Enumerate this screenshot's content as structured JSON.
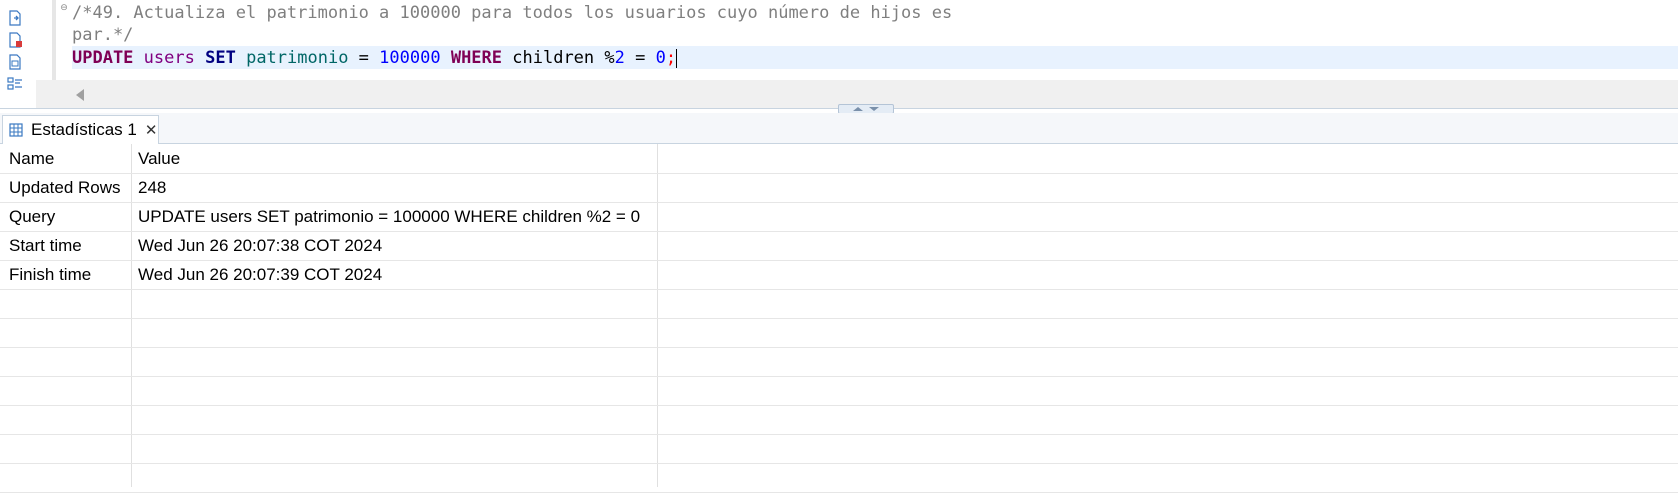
{
  "editor": {
    "comment_line1": "/*49. Actualiza el patrimonio a 100000 para todos los usuarios cuyo número de hijos es",
    "comment_line2": "par.*/",
    "sql": {
      "kw_update": "UPDATE",
      "table": "users",
      "kw_set": "SET",
      "column": "patrimonio",
      "eq1": " = ",
      "value": "100000",
      "kw_where": "WHERE",
      "cond_col": "children",
      "mod": " %",
      "mod_num": "2",
      "eq2": " = ",
      "zero": "0",
      "semicolon": ";"
    },
    "toolbar_icons": [
      "execute-statement-icon",
      "execute-script-icon",
      "explain-plan-icon",
      "outline-icon"
    ]
  },
  "results": {
    "tab_label": "Estadísticas 1",
    "tab_close": "✕",
    "columns": [
      "Name",
      "Value"
    ],
    "rows": [
      [
        "Updated Rows",
        "248"
      ],
      [
        "Query",
        "UPDATE users SET patrimonio = 100000 WHERE children %2 = 0"
      ],
      [
        "Start time",
        "Wed Jun 26 20:07:38 COT 2024"
      ],
      [
        "Finish time",
        "Wed Jun 26 20:07:39 COT 2024"
      ]
    ]
  },
  "colors": {
    "keyword": "#7f0055",
    "set_keyword": "#000080",
    "table_name": "#800080",
    "column_name": "#006666",
    "number": "#0000ff",
    "comment": "#7f7f7f",
    "current_line": "#e8f2fe"
  }
}
